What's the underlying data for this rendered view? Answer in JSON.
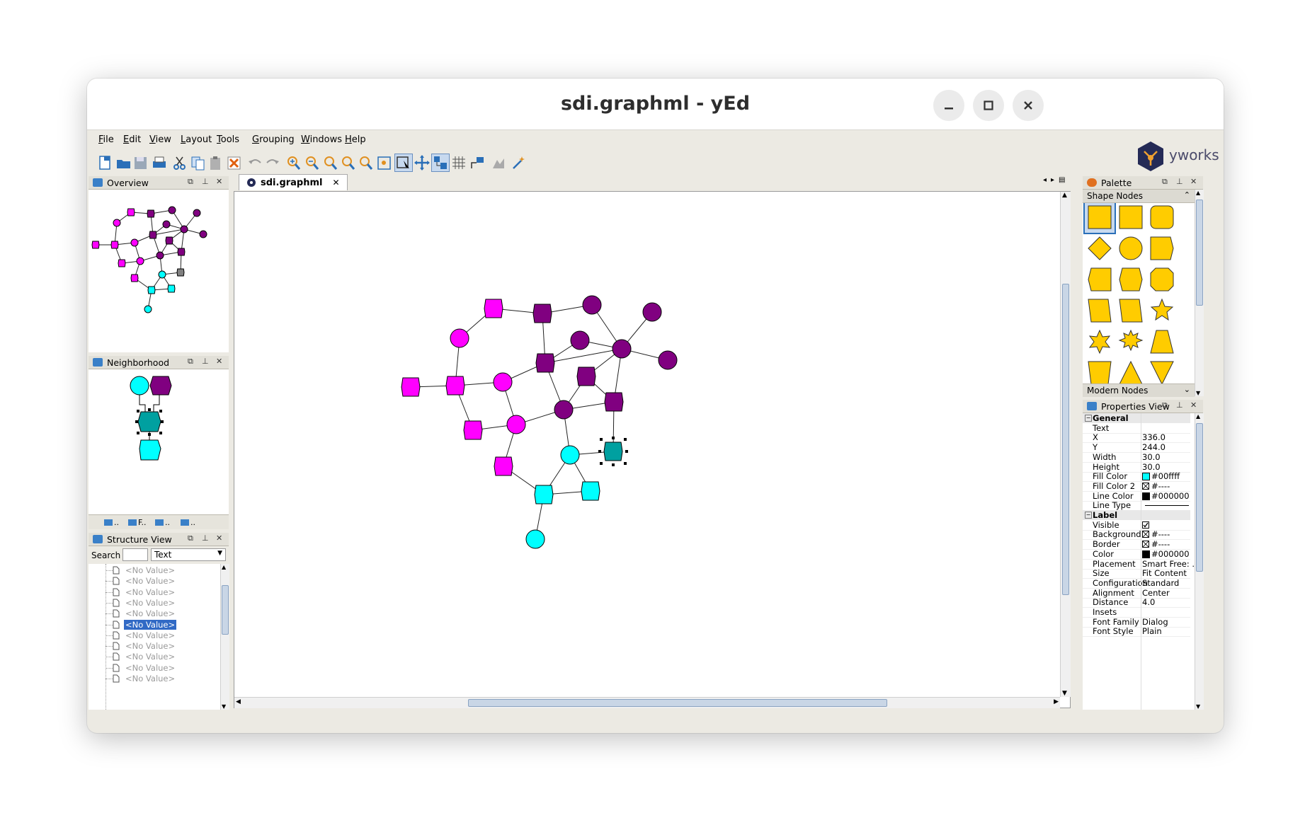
{
  "window": {
    "title": "sdi.graphml - yEd"
  },
  "menu": [
    {
      "label": "File",
      "mn": "F",
      "rest": "ile"
    },
    {
      "label": "Edit",
      "mn": "E",
      "rest": "dit"
    },
    {
      "label": "View",
      "mn": "V",
      "rest": "iew"
    },
    {
      "label": "Layout",
      "mn": "L",
      "rest": "ayout"
    },
    {
      "label": "Tools",
      "mn": "T",
      "rest": "ools"
    },
    {
      "label": "Grouping",
      "mn": "G",
      "rest": "rouping"
    },
    {
      "label": "Windows",
      "mn": "W",
      "rest": "indows"
    },
    {
      "label": "Help",
      "mn": "H",
      "rest": "elp"
    }
  ],
  "brand": {
    "name": "yworks"
  },
  "panels": {
    "overview": "Overview",
    "neighborhood": "Neighborhood",
    "structure": "Structure View",
    "palette": "Palette",
    "properties": "Properties View"
  },
  "neighborhood_tabs": [
    "..",
    "F..",
    "..",
    ".."
  ],
  "document_tab": "sdi.graphml",
  "structure": {
    "search_label": "Search",
    "search_value": "",
    "search_mode": "Text",
    "rows": [
      "<No Value>",
      "<No Value>",
      "<No Value>",
      "<No Value>",
      "<No Value>",
      "<No Value>",
      "<No Value>",
      "<No Value>",
      "<No Value>",
      "<No Value>",
      "<No Value>"
    ],
    "selected_index": 5
  },
  "palette": {
    "section_open": "Shape Nodes",
    "section_next": "Modern Nodes"
  },
  "properties": {
    "sections": [
      {
        "title": "General",
        "rows": [
          {
            "key": "Text",
            "value": ""
          },
          {
            "key": "X",
            "value": "336.0"
          },
          {
            "key": "Y",
            "value": "244.0"
          },
          {
            "key": "Width",
            "value": "30.0"
          },
          {
            "key": "Height",
            "value": "30.0"
          },
          {
            "key": "Fill Color",
            "value": "#00ffff",
            "swatch": "#00ffff"
          },
          {
            "key": "Fill Color 2",
            "value": "#----",
            "swatch": "none"
          },
          {
            "key": "Line Color",
            "value": "#000000",
            "swatch": "#000000"
          },
          {
            "key": "Line Type",
            "value": "",
            "line": true
          }
        ]
      },
      {
        "title": "Label",
        "rows": [
          {
            "key": "Visible",
            "value": "",
            "check": true
          },
          {
            "key": "Background",
            "value": "#----",
            "swatch": "none"
          },
          {
            "key": "Border",
            "value": "#----",
            "swatch": "none"
          },
          {
            "key": "Color",
            "value": "#000000",
            "swatch": "#000000"
          },
          {
            "key": "Placement",
            "value": "Smart Free: ..."
          },
          {
            "key": "Size",
            "value": "Fit Content"
          },
          {
            "key": "Configuration",
            "value": "Standard"
          },
          {
            "key": "Alignment",
            "value": "Center"
          },
          {
            "key": "Distance",
            "value": "4.0"
          },
          {
            "key": "Insets",
            "value": ""
          },
          {
            "key": "Font Family",
            "value": "Dialog"
          },
          {
            "key": "Font Style",
            "value": "Plain"
          }
        ]
      }
    ]
  },
  "colors": {
    "magenta": "#ff00ff",
    "purple": "#800080",
    "cyan": "#00ffff",
    "teal": "#00a0a0",
    "gray": "#808080",
    "palette_yellow": "#ffcc00",
    "selection": "#316ac5"
  }
}
